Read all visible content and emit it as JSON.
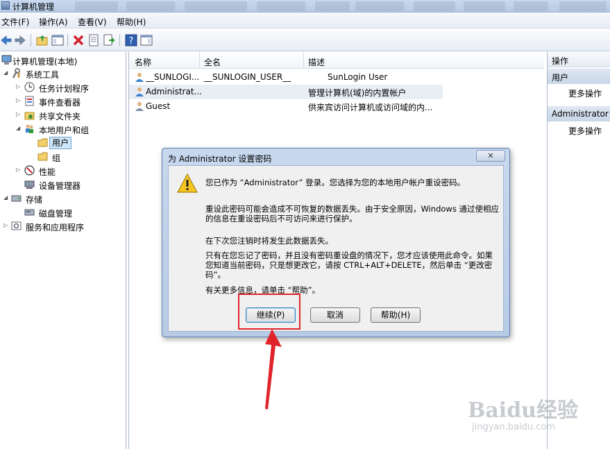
{
  "window": {
    "title": "计算机管理"
  },
  "menu": [
    "文件(F)",
    "操作(A)",
    "查看(V)",
    "帮助(H)"
  ],
  "tree": {
    "root": "计算机管理(本地)",
    "system_tools": "系统工具",
    "task_scheduler": "任务计划程序",
    "event_viewer": "事件查看器",
    "shared_folders": "共享文件夹",
    "local_users_groups": "本地用户和组",
    "users": "用户",
    "groups": "组",
    "performance": "性能",
    "device_manager": "设备管理器",
    "storage": "存储",
    "disk_management": "磁盘管理",
    "services_apps": "服务和应用程序"
  },
  "list": {
    "columns": [
      "名称",
      "全名",
      "描述"
    ],
    "rows": [
      {
        "name": "__SUNLOGI...",
        "fullname": "__SUNLOGIN_USER__",
        "desc": "SunLogin User"
      },
      {
        "name": "Administrat...",
        "fullname": "",
        "desc": "管理计算机(域)的内置帐户"
      },
      {
        "name": "Guest",
        "fullname": "",
        "desc": "供来宾访问计算机或访问域的内..."
      }
    ]
  },
  "actions": {
    "header": "操作",
    "section1": "用户",
    "section1_more": "更多操作",
    "section2": "Administrator",
    "section2_more": "更多操作"
  },
  "dialog": {
    "title": "为 Administrator 设置密码",
    "p1": "您已作为 “Administrator” 登录。您选择为您的本地用户帐户重设密码。",
    "p2": "重设此密码可能会造成不可恢复的数据丢失。由于安全原因，Windows 通过使相应的信息在重设密码后不可访问来进行保护。",
    "p3": "在下次您注销时将发生此数据丢失。",
    "p4": "只有在您忘记了密码，并且没有密码重设盘的情况下，您才应该使用此命令。如果您知道当前密码，只是想更改它，请按 CTRL+ALT+DELETE，然后单击 “更改密码”。",
    "p5": "有关更多信息，请单击 “帮助”。",
    "btn_continue": "继续(P)",
    "btn_cancel": "取消",
    "btn_help": "帮助(H)"
  },
  "watermark": {
    "brand": "Baidu经验",
    "url": "jingyan.baidu.com"
  },
  "colors": {
    "highlight_red": "#e0242a",
    "selection": "#cde6f7"
  }
}
